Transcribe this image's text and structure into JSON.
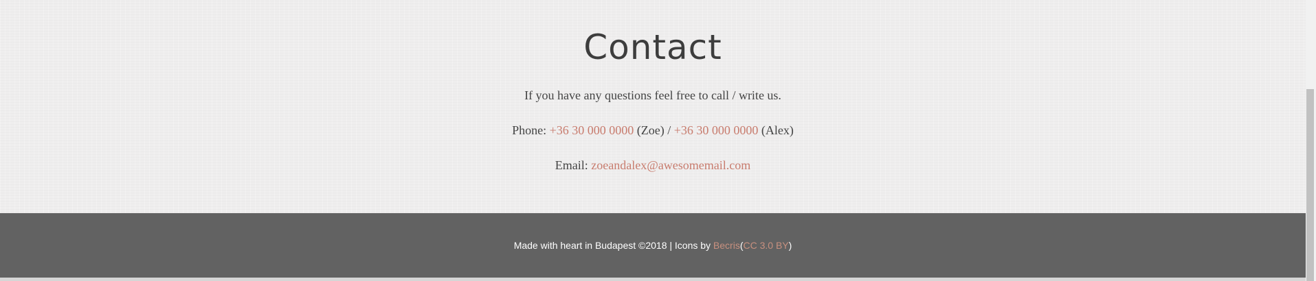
{
  "contact": {
    "title": "Contact",
    "intro": "If you have any questions feel free to call / write us.",
    "phone_label": "Phone:",
    "phone_1": "+36 30 000 0000",
    "phone_1_name": "(Zoe)",
    "phone_separator": "/",
    "phone_2": "+36 30 000 0000",
    "phone_2_name": "(Alex)",
    "email_label": "Email:",
    "email": "zoeandalex@awesomemail.com"
  },
  "footer": {
    "text_before": "Made with heart in Budapest ©2018 | Icons by",
    "icons_author": "Becris",
    "paren_open": "(",
    "license": "CC 3.0 BY",
    "paren_close": ")"
  },
  "colors": {
    "background": "#efeeee",
    "text": "#444444",
    "link": "#c87c6e",
    "footer_background": "#626262",
    "footer_text": "#ffffff",
    "footer_link": "#c8907f"
  }
}
